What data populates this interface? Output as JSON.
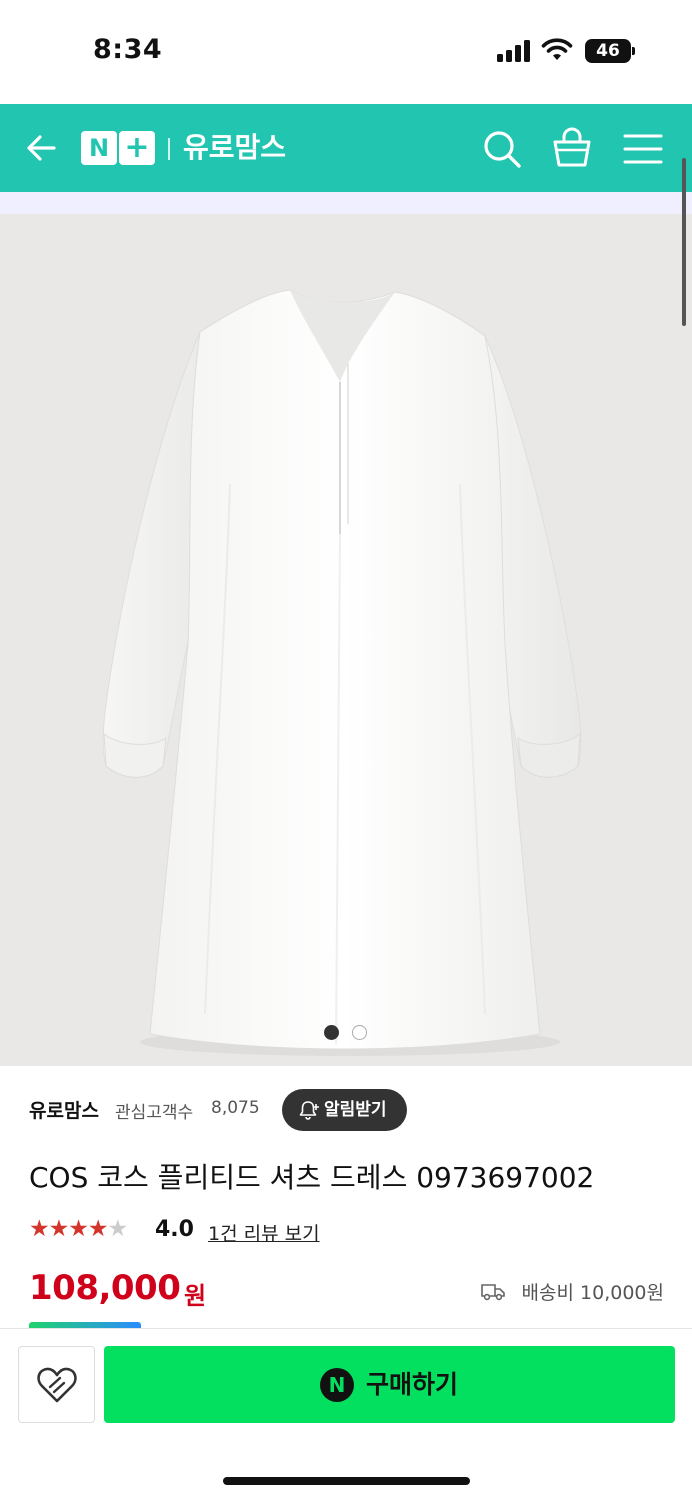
{
  "status_bar": {
    "time": "8:34",
    "battery": "46",
    "icons": [
      "signal-icon",
      "wifi-icon",
      "battery-icon"
    ]
  },
  "header": {
    "logo_n": "N",
    "logo_plus": "+",
    "store_name": "유로맘스",
    "icons": [
      "back-arrow-icon",
      "search-icon",
      "shopping-basket-icon",
      "hamburger-menu-icon"
    ],
    "background_color": "#21c5b0"
  },
  "gallery": {
    "image_subject": "white-shirt-dress",
    "total_images": 2,
    "current_index": 1
  },
  "seller": {
    "name": "유로맘스",
    "follower_label": "관심고객수",
    "follower_count": "8,075",
    "alarm_button": "알림받기"
  },
  "product": {
    "title": "COS 코스 플리티드 셔츠 드레스 0973697002",
    "rating_stars": 4,
    "rating_max": 5,
    "rating_value": "4.0",
    "review_link": "1건 리뷰 보기",
    "price": "108,000",
    "price_unit": "원",
    "shipping": "배송비 10,000원",
    "price_color": "#d0021b"
  },
  "purchase_bar": {
    "buy_icon_letter": "N",
    "buy_label": "구매하기",
    "buy_color": "#03e05f",
    "wish_icon": "heart-icon"
  }
}
